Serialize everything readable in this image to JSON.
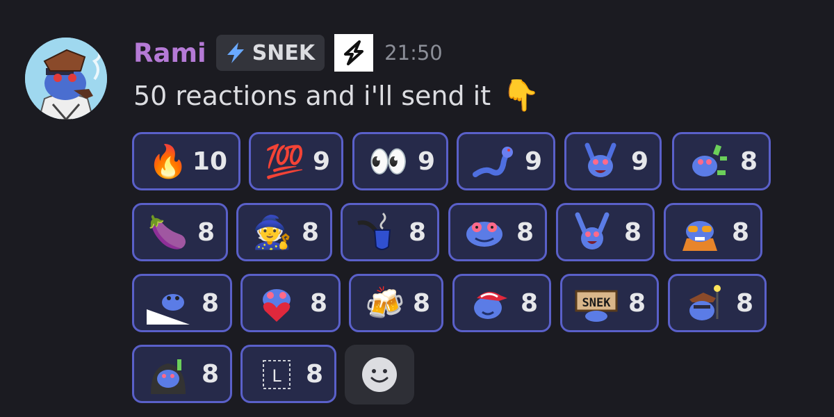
{
  "user": {
    "name": "Rami",
    "tag_label": "SNEK",
    "timestamp": "21:50"
  },
  "message": {
    "text": "50 reactions and i'll send it",
    "emoji": "👇"
  },
  "reactions": [
    {
      "emoji": "🔥",
      "icon": "fire-icon",
      "count": "10"
    },
    {
      "emoji": "💯",
      "icon": "hundred-points-icon",
      "count": "9"
    },
    {
      "emoji": "👀",
      "icon": "eyes-icon",
      "count": "9"
    },
    {
      "emoji": "",
      "icon": "snake-emoji-icon",
      "count": "9"
    },
    {
      "emoji": "",
      "icon": "frog-cheer-emoji-icon",
      "count": "9"
    },
    {
      "emoji": "",
      "icon": "frog-money-emoji-icon",
      "count": "8"
    },
    {
      "emoji": "🍆",
      "icon": "eggplant-icon",
      "count": "8"
    },
    {
      "emoji": "🧙",
      "icon": "mage-icon",
      "count": "8"
    },
    {
      "emoji": "",
      "icon": "pipe-emoji-icon",
      "count": "8"
    },
    {
      "emoji": "",
      "icon": "frog-face-emoji-icon",
      "count": "8"
    },
    {
      "emoji": "",
      "icon": "frog-arms-up-emoji-icon",
      "count": "8"
    },
    {
      "emoji": "",
      "icon": "frog-sunglasses-emoji-icon",
      "count": "8"
    },
    {
      "emoji": "",
      "icon": "frog-peek-emoji-icon",
      "count": "8"
    },
    {
      "emoji": "",
      "icon": "frog-heart-emoji-icon",
      "count": "8"
    },
    {
      "emoji": "🍻",
      "icon": "beer-mugs-icon",
      "count": "8"
    },
    {
      "emoji": "",
      "icon": "frog-cap-emoji-icon",
      "count": "8"
    },
    {
      "emoji": "",
      "icon": "snek-sign-emoji-icon",
      "count": "8",
      "sign_text": "SNEK"
    },
    {
      "emoji": "",
      "icon": "frog-wizard-emoji-icon",
      "count": "8"
    },
    {
      "emoji": "",
      "icon": "frog-hoodie-emoji-icon",
      "count": "8"
    },
    {
      "emoji": "",
      "icon": "l-box-emoji-icon",
      "count": "8",
      "box_text": "L"
    }
  ],
  "add_reaction": {
    "icon": "add-reaction-smiley-icon"
  }
}
